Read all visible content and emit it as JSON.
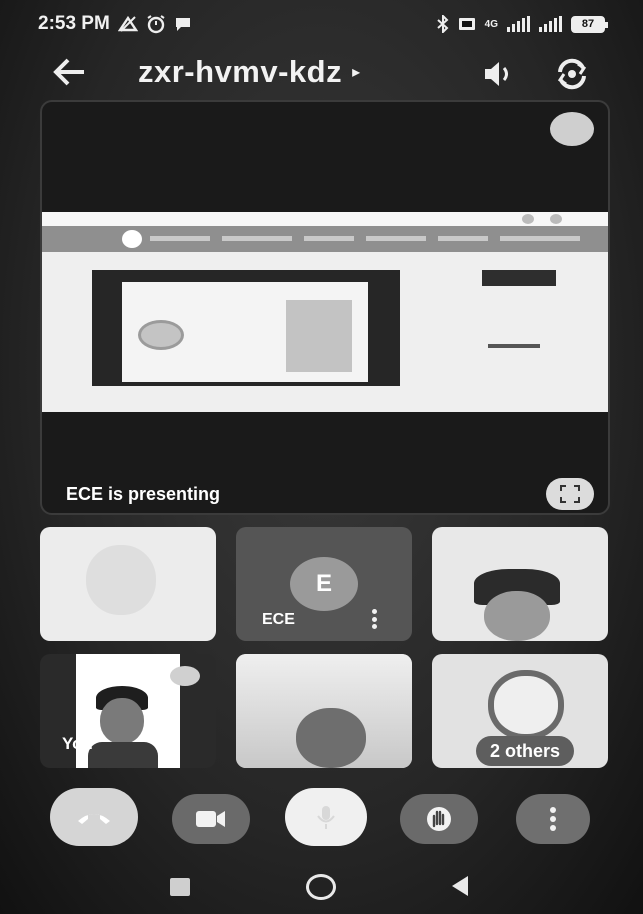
{
  "status_bar": {
    "time": "2:53 PM",
    "network_type": "4G",
    "battery": "87"
  },
  "header": {
    "meeting_code": "zxr-hvmv-kdz",
    "title_arrow": "▸"
  },
  "presentation": {
    "presenting_text": "ECE is presenting"
  },
  "participants": [
    {
      "name": "",
      "kind": "video"
    },
    {
      "name": "ECE",
      "avatar_letter": "E",
      "kind": "avatar"
    },
    {
      "name": "",
      "kind": "video"
    },
    {
      "name": "You",
      "kind": "self"
    },
    {
      "name": "",
      "kind": "video"
    },
    {
      "name": "2 others",
      "kind": "group"
    }
  ],
  "controls": {
    "items": [
      "end-call",
      "camera",
      "microphone",
      "raise-hand",
      "more-options"
    ]
  },
  "colors": {
    "background": "#262626",
    "tile_dark": "#555555",
    "control_grey": "#6a6a6a"
  }
}
